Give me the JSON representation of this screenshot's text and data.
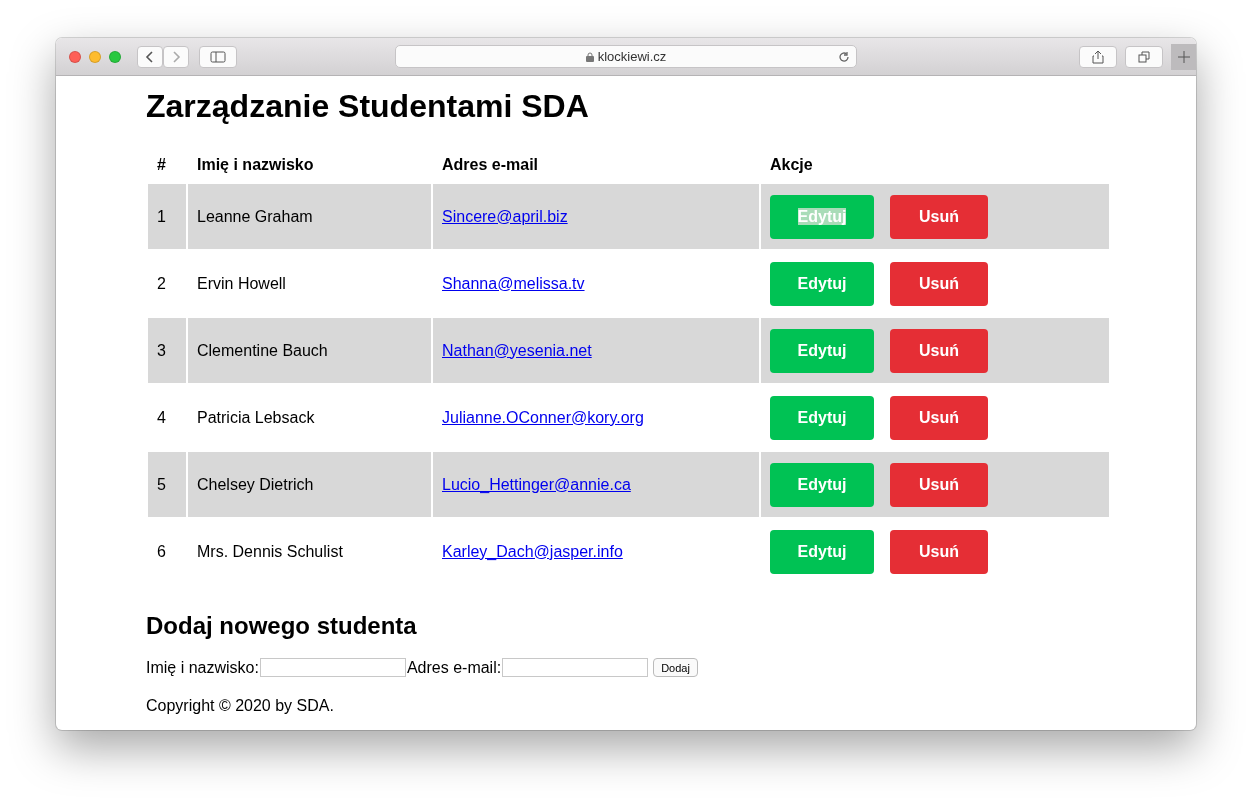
{
  "browser": {
    "url": "klockiewi.cz"
  },
  "page": {
    "title": "Zarządzanie Studentami SDA",
    "table": {
      "columns": [
        "#",
        "Imię i nazwisko",
        "Adres e-mail",
        "Akcje"
      ],
      "rows": [
        {
          "number": "1",
          "name": "Leanne Graham",
          "email": "Sincere@april.biz",
          "edit": "Edytuj",
          "delete": "Usuń",
          "edit_text_selected": true
        },
        {
          "number": "2",
          "name": "Ervin Howell",
          "email": "Shanna@melissa.tv",
          "edit": "Edytuj",
          "delete": "Usuń",
          "edit_text_selected": false
        },
        {
          "number": "3",
          "name": "Clementine Bauch",
          "email": "Nathan@yesenia.net",
          "edit": "Edytuj",
          "delete": "Usuń",
          "edit_text_selected": false
        },
        {
          "number": "4",
          "name": "Patricia Lebsack",
          "email": "Julianne.OConner@kory.org",
          "edit": "Edytuj",
          "delete": "Usuń",
          "edit_text_selected": false
        },
        {
          "number": "5",
          "name": "Chelsey Dietrich",
          "email": "Lucio_Hettinger@annie.ca",
          "edit": "Edytuj",
          "delete": "Usuń",
          "edit_text_selected": false
        },
        {
          "number": "6",
          "name": "Mrs. Dennis Schulist",
          "email": "Karley_Dach@jasper.info",
          "edit": "Edytuj",
          "delete": "Usuń",
          "edit_text_selected": false
        }
      ]
    },
    "form": {
      "title": "Dodaj nowego studenta",
      "name_label": "Imię i nazwisko:",
      "email_label": "Adres e-mail:",
      "submit": "Dodaj"
    },
    "footer": "Copyright © 2020 by SDA."
  }
}
